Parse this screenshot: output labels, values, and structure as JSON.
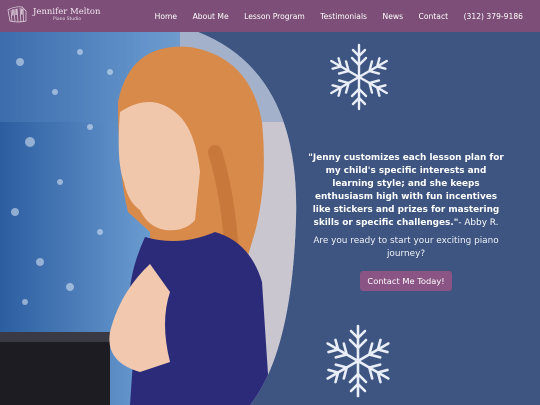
{
  "nav": {
    "logo_name": "Jennifer Melton",
    "logo_subtitle": "Piano Studio",
    "items": [
      {
        "label": "Home"
      },
      {
        "label": "About Me"
      },
      {
        "label": "Lesson Program"
      },
      {
        "label": "Testimonials"
      },
      {
        "label": "News"
      },
      {
        "label": "Contact"
      },
      {
        "label": "(312) 379-9186"
      }
    ]
  },
  "hero": {
    "quote": "\"Jenny customizes each lesson plan for my child's specific interests and learning style; and she keeps enthusiasm high with fun incentives like stickers and prizes for mastering skills or specific challenges.\"",
    "quote_author": "- Abby R.",
    "prompt": "Are you ready to start your exciting piano journey?",
    "cta_label": "Contact Me Today!"
  },
  "colors": {
    "nav_bg": "#7d4f78",
    "hero_bg": "#3d5580",
    "cta_bg": "#8a5585"
  },
  "icons": [
    "piano-keys-logo-icon",
    "snowflake-icon"
  ]
}
